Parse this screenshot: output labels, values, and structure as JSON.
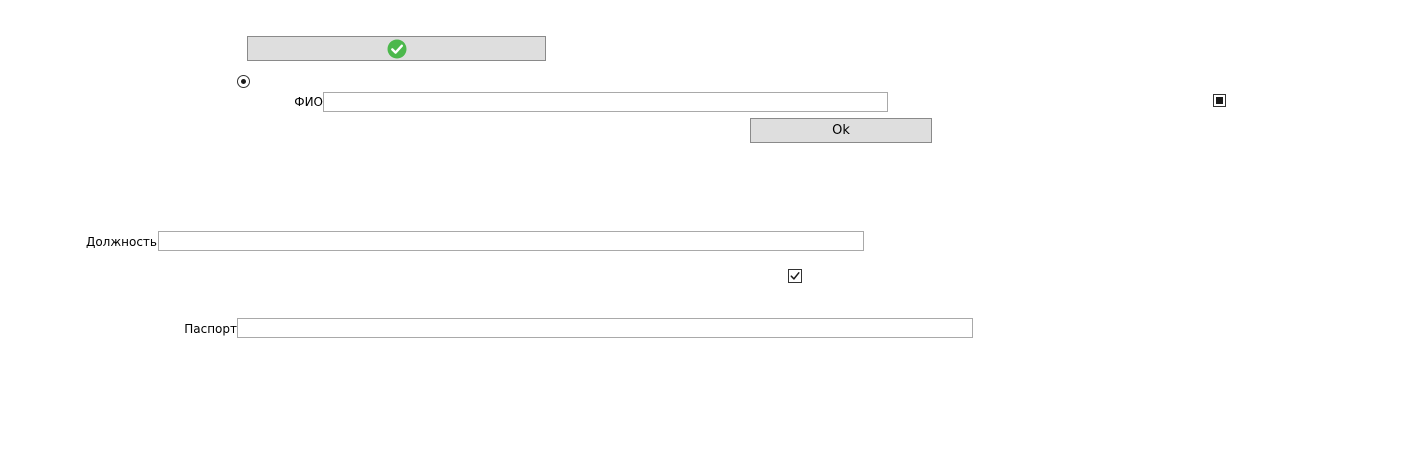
{
  "top_button": {
    "icon": "check-circle-icon",
    "icon_color": "#4cb84c"
  },
  "fio": {
    "label": "ФИО",
    "value": "",
    "placeholder": ""
  },
  "ok_button": {
    "label": "Ok"
  },
  "position": {
    "label": "Должность",
    "value": "",
    "placeholder": ""
  },
  "passport": {
    "label": "Паспорт",
    "value": "",
    "placeholder": ""
  },
  "radio_option": {
    "state": "selected"
  },
  "indeterminate_checkbox": {
    "state": "indeterminate"
  },
  "checkbox": {
    "state": "checked"
  },
  "colors": {
    "button_bg": "#dedede",
    "button_border": "#8a8a8a",
    "field_border": "#a9a9a9",
    "check_green": "#4cb84c"
  }
}
